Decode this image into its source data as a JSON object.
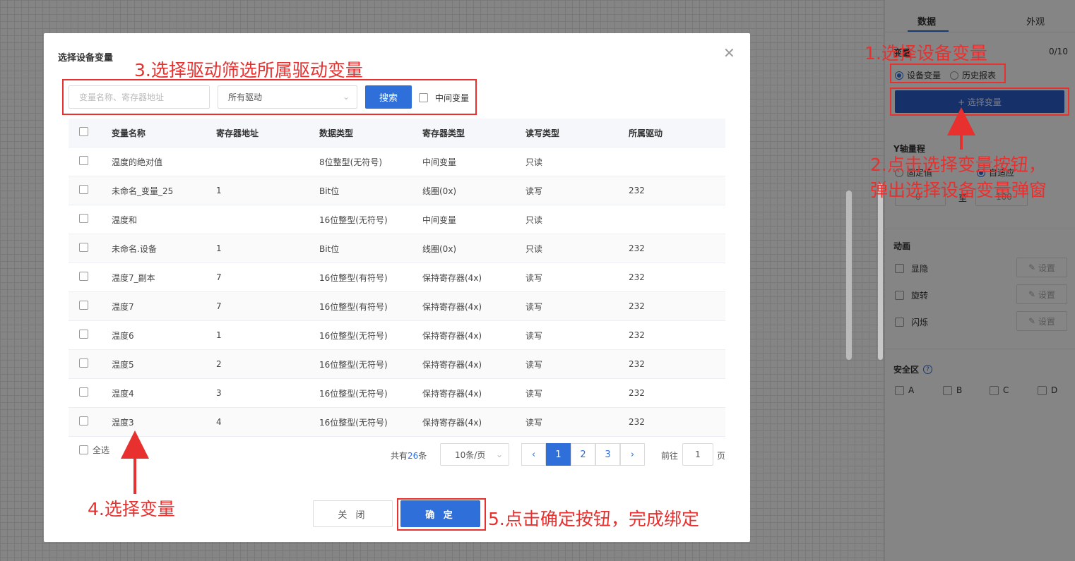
{
  "panel": {
    "tabs": [
      "数据",
      "外观"
    ],
    "variable_label": "变量",
    "variable_count": "0/10",
    "source_options": [
      {
        "label": "设备变量",
        "selected": true
      },
      {
        "label": "历史报表",
        "selected": false
      }
    ],
    "select_variable_button": "+ 选择变量",
    "y_axis_label": "Y轴量程",
    "y_axis_options": [
      {
        "label": "固定值",
        "selected": false
      },
      {
        "label": "自适应",
        "selected": true
      }
    ],
    "y_min": "0",
    "y_to": "至",
    "y_max": "100",
    "animation_label": "动画",
    "animation_items": [
      "显隐",
      "旋转",
      "闪烁"
    ],
    "set_label": "设置",
    "safety_label": "安全区",
    "safety_zones": [
      "A",
      "B",
      "C",
      "D"
    ]
  },
  "dialog": {
    "title": "选择设备变量",
    "search_placeholder": "变量名称、寄存器地址",
    "driver_select": "所有驱动",
    "search_button": "搜索",
    "middle_variable": "中间变量",
    "columns": [
      "变量名称",
      "寄存器地址",
      "数据类型",
      "寄存器类型",
      "读写类型",
      "所属驱动"
    ],
    "rows": [
      [
        "温度的绝对值",
        "",
        "8位整型(无符号)",
        "中间变量",
        "只读",
        ""
      ],
      [
        "未命名_变量_25",
        "1",
        "Bit位",
        "线圈(0x)",
        "读写",
        "232"
      ],
      [
        "温度和",
        "",
        "16位整型(无符号)",
        "中间变量",
        "只读",
        ""
      ],
      [
        "未命名.设备",
        "1",
        "Bit位",
        "线圈(0x)",
        "只读",
        "232"
      ],
      [
        "温度7_副本",
        "7",
        "16位整型(有符号)",
        "保持寄存器(4x)",
        "读写",
        "232"
      ],
      [
        "温度7",
        "7",
        "16位整型(有符号)",
        "保持寄存器(4x)",
        "读写",
        "232"
      ],
      [
        "温度6",
        "1",
        "16位整型(无符号)",
        "保持寄存器(4x)",
        "读写",
        "232"
      ],
      [
        "温度5",
        "2",
        "16位整型(无符号)",
        "保持寄存器(4x)",
        "读写",
        "232"
      ],
      [
        "温度4",
        "3",
        "16位整型(无符号)",
        "保持寄存器(4x)",
        "读写",
        "232"
      ],
      [
        "温度3",
        "4",
        "16位整型(无符号)",
        "保持寄存器(4x)",
        "读写",
        "232"
      ]
    ],
    "select_all": "全选",
    "total_prefix": "共有",
    "total_count": "26",
    "total_suffix": "条",
    "page_size": "10条/页",
    "pages": [
      "1",
      "2",
      "3"
    ],
    "current_page": "1",
    "goto_prefix": "前往",
    "goto_value": "1",
    "goto_suffix": "页",
    "close_button": "关 闭",
    "confirm_button": "确 定"
  },
  "annotations": {
    "step1": "1.选择设备变量",
    "step2_line1": "2.点击选择变量按钮，",
    "step2_line2": "弹出选择设备变量弹窗",
    "step3": "3.选择驱动筛选所属驱动变量",
    "step4": "4.选择变量",
    "step5": "5.点击确定按钮，完成绑定",
    "color": "#e8302f"
  },
  "colors": {
    "primary": "#2e6fd9",
    "dark_primary": "#2b5ec9",
    "annotation": "#e8302f"
  }
}
